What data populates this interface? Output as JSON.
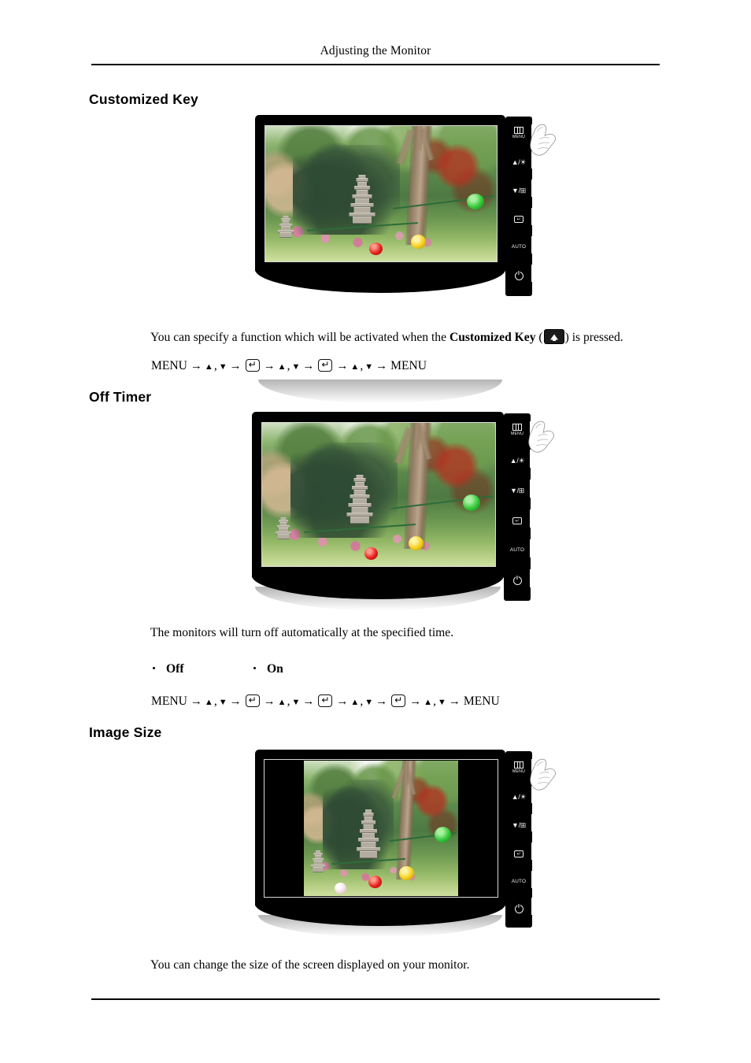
{
  "document": {
    "running_header": "Adjusting the Monitor"
  },
  "sections": [
    {
      "id": "customized-key",
      "heading": "Customized Key",
      "figure": {
        "alt": "Samsung LCD monitor front view with side control panel and hand pressing MENU button",
        "screen_mode": "full",
        "controls": [
          {
            "name": "menu-button",
            "glyph": "menu-bars",
            "label": "MENU"
          },
          {
            "name": "brightness-up-button",
            "glyph": "▲/☀",
            "label": ""
          },
          {
            "name": "source-down-button",
            "glyph": "▼/⊞",
            "label": ""
          },
          {
            "name": "enter-button",
            "glyph": "↵",
            "label": ""
          },
          {
            "name": "auto-button",
            "glyph": "",
            "label": "AUTO"
          },
          {
            "name": "power-button",
            "glyph": "power",
            "label": ""
          }
        ]
      },
      "description_parts": [
        {
          "type": "text",
          "value": "You can specify a function which will be activated when the "
        },
        {
          "type": "bold",
          "value": "Customized Key"
        },
        {
          "type": "text",
          "value": " ("
        },
        {
          "type": "icon",
          "value": "customized-key-button"
        },
        {
          "type": "text",
          "value": ") is pressed."
        }
      ],
      "menu_path": [
        {
          "type": "text",
          "value": "MENU"
        },
        {
          "type": "arrow",
          "value": "→"
        },
        {
          "type": "up",
          "value": "▲"
        },
        {
          "type": "comma",
          "value": ","
        },
        {
          "type": "down",
          "value": "▼"
        },
        {
          "type": "arrow",
          "value": "→"
        },
        {
          "type": "enter",
          "value": "↵"
        },
        {
          "type": "arrow",
          "value": "→"
        },
        {
          "type": "up",
          "value": "▲"
        },
        {
          "type": "comma",
          "value": ","
        },
        {
          "type": "down",
          "value": "▼"
        },
        {
          "type": "arrow",
          "value": "→"
        },
        {
          "type": "enter",
          "value": "↵"
        },
        {
          "type": "arrow",
          "value": "→"
        },
        {
          "type": "up",
          "value": "▲"
        },
        {
          "type": "comma",
          "value": ","
        },
        {
          "type": "down",
          "value": "▼"
        },
        {
          "type": "arrow",
          "value": "→"
        },
        {
          "type": "text",
          "value": "MENU"
        }
      ]
    },
    {
      "id": "off-timer",
      "heading": "Off Timer",
      "figure": {
        "alt": "Samsung LCD monitor front view with side control panel and hand pressing MENU button",
        "screen_mode": "full",
        "controls": [
          {
            "name": "menu-button",
            "glyph": "menu-bars",
            "label": "MENU"
          },
          {
            "name": "brightness-up-button",
            "glyph": "▲/☀",
            "label": ""
          },
          {
            "name": "source-down-button",
            "glyph": "▼/⊞",
            "label": ""
          },
          {
            "name": "enter-button",
            "glyph": "↵",
            "label": ""
          },
          {
            "name": "auto-button",
            "glyph": "",
            "label": "AUTO"
          },
          {
            "name": "power-button",
            "glyph": "power",
            "label": ""
          }
        ]
      },
      "description": "The monitors will turn off automatically at the specified time.",
      "options": [
        "Off",
        "On"
      ],
      "menu_path": [
        {
          "type": "text",
          "value": "MENU"
        },
        {
          "type": "arrow",
          "value": "→"
        },
        {
          "type": "up",
          "value": "▲"
        },
        {
          "type": "comma",
          "value": ","
        },
        {
          "type": "down",
          "value": "▼"
        },
        {
          "type": "arrow",
          "value": "→"
        },
        {
          "type": "enter",
          "value": "↵"
        },
        {
          "type": "arrow",
          "value": "→"
        },
        {
          "type": "up",
          "value": "▲"
        },
        {
          "type": "comma",
          "value": ","
        },
        {
          "type": "down",
          "value": "▼"
        },
        {
          "type": "arrow",
          "value": "→"
        },
        {
          "type": "enter",
          "value": "↵"
        },
        {
          "type": "arrow",
          "value": "→"
        },
        {
          "type": "up",
          "value": "▲"
        },
        {
          "type": "comma",
          "value": ","
        },
        {
          "type": "down",
          "value": "▼"
        },
        {
          "type": "arrow",
          "value": "→"
        },
        {
          "type": "enter",
          "value": "↵"
        },
        {
          "type": "arrow",
          "value": "→"
        },
        {
          "type": "up",
          "value": "▲"
        },
        {
          "type": "comma",
          "value": ","
        },
        {
          "type": "down",
          "value": "▼"
        },
        {
          "type": "arrow",
          "value": "→"
        },
        {
          "type": "text",
          "value": "MENU"
        }
      ]
    },
    {
      "id": "image-size",
      "heading": "Image Size",
      "figure": {
        "alt": "Samsung LCD monitor showing letterboxed 4:3 image with black side bars",
        "screen_mode": "letterbox",
        "controls": [
          {
            "name": "menu-button",
            "glyph": "menu-bars",
            "label": "MENU"
          },
          {
            "name": "brightness-up-button",
            "glyph": "▲/☀",
            "label": ""
          },
          {
            "name": "source-down-button",
            "glyph": "▼/⊞",
            "label": ""
          },
          {
            "name": "enter-button",
            "glyph": "↵",
            "label": ""
          },
          {
            "name": "auto-button",
            "glyph": "",
            "label": "AUTO"
          },
          {
            "name": "power-button",
            "glyph": "power",
            "label": ""
          }
        ]
      },
      "description": "You can change the size of the screen displayed on your monitor."
    }
  ],
  "colors": {
    "text": "#000000",
    "bezel": "#000000",
    "rule": "#000000",
    "page_background": "#ffffff"
  }
}
